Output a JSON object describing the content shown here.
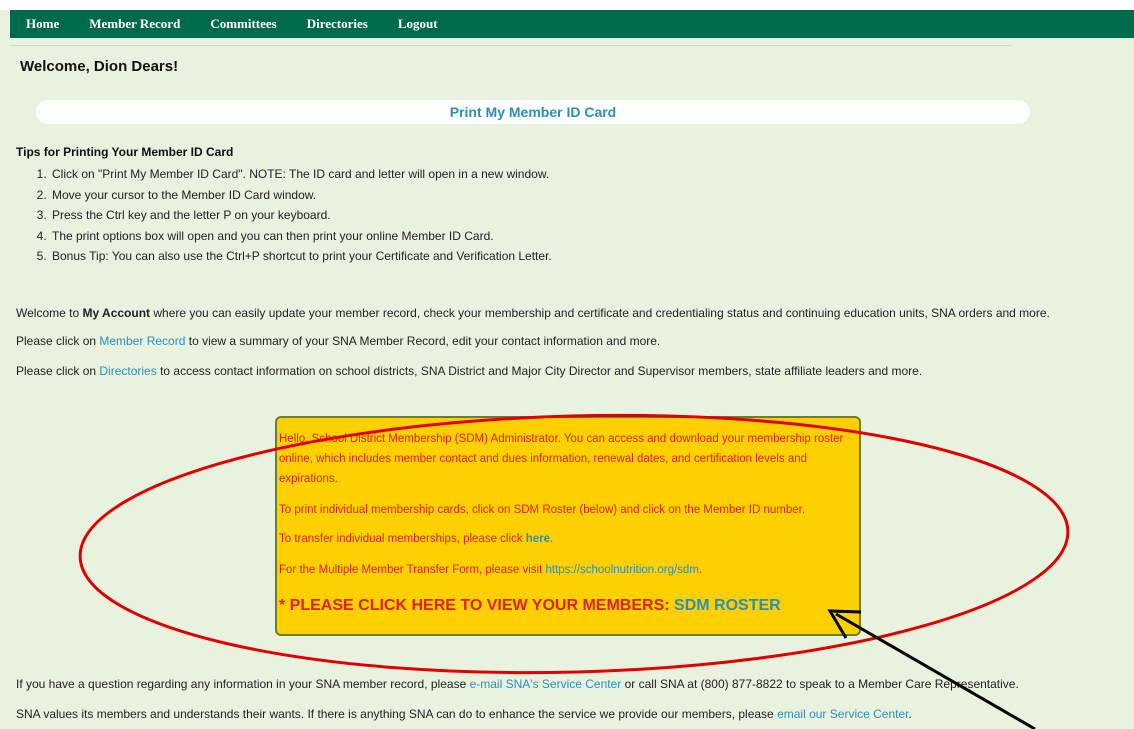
{
  "nav": {
    "items": [
      "Home",
      "Member Record",
      "Committees",
      "Directories",
      "Logout"
    ]
  },
  "welcome": "Welcome, Dion Dears!",
  "print_card_link": "Print My Member ID Card",
  "tips": {
    "title": "Tips for Printing Your Member ID Card",
    "items": [
      "Click on \"Print My Member ID Card\". NOTE: The ID card and letter will open in a new window.",
      "Move your cursor to the Member ID Card window.",
      "Press the Ctrl key and the letter P on your keyboard.",
      "The print options box will open and you can then print your online Member ID Card.",
      "Bonus Tip: You can also use the Ctrl+P shortcut to print your Certificate and Verification Letter."
    ]
  },
  "intro": {
    "prefix": "Welcome to ",
    "bold": "My Account",
    "suffix": " where you can easily update your member record, check your membership and certificate and credentialing status and continuing education units, SNA orders and more."
  },
  "member_record_para": {
    "prefix": "Please click on ",
    "link": "Member Record",
    "suffix": " to view a summary of your SNA Member Record, edit your contact information and more."
  },
  "directories_para": {
    "prefix": "Please click on ",
    "link": "Directories",
    "suffix": " to access contact information on school districts, SNA District and Major City Director and Supervisor members, state affiliate leaders and more."
  },
  "sdm": {
    "intro": "Hello, School District Membership (SDM) Administrator. You can access and download your membership roster online, which includes member contact and dues information, renewal dates, and certification levels and expirations.",
    "print_cards": "To print individual membership cards, click on SDM Roster (below) and click on the Member ID number.",
    "transfer_prefix": "To transfer individual memberships, please click ",
    "transfer_link": "here",
    "transfer_suffix": ".",
    "multi_prefix": "For the Multiple Member Transfer Form, please visit ",
    "multi_link": "https://schoolnutrition.org/sdm",
    "multi_suffix": ".",
    "cta_prefix": "* PLEASE CLICK HERE TO VIEW YOUR MEMBERS: ",
    "cta_link": "SDM ROSTER"
  },
  "question_para": {
    "prefix": "If you have a question regarding any information in your SNA member record, please ",
    "link": "e-mail SNA's Service Center",
    "suffix": " or call SNA at (800) 877-8822 to speak to a Member Care Representative."
  },
  "values_para": {
    "prefix": "SNA values its members and understands their wants. If there is anything SNA can do to enhance the service we provide our members, please ",
    "link": "email our Service Center",
    "suffix": "."
  },
  "colors": {
    "nav_bg": "#006b4c",
    "page_bg": "#e8f2df",
    "link": "#2a8fbd",
    "sdm_bg": "#ffd000",
    "sdm_text": "#e0201b",
    "annotation": "#e00000"
  }
}
